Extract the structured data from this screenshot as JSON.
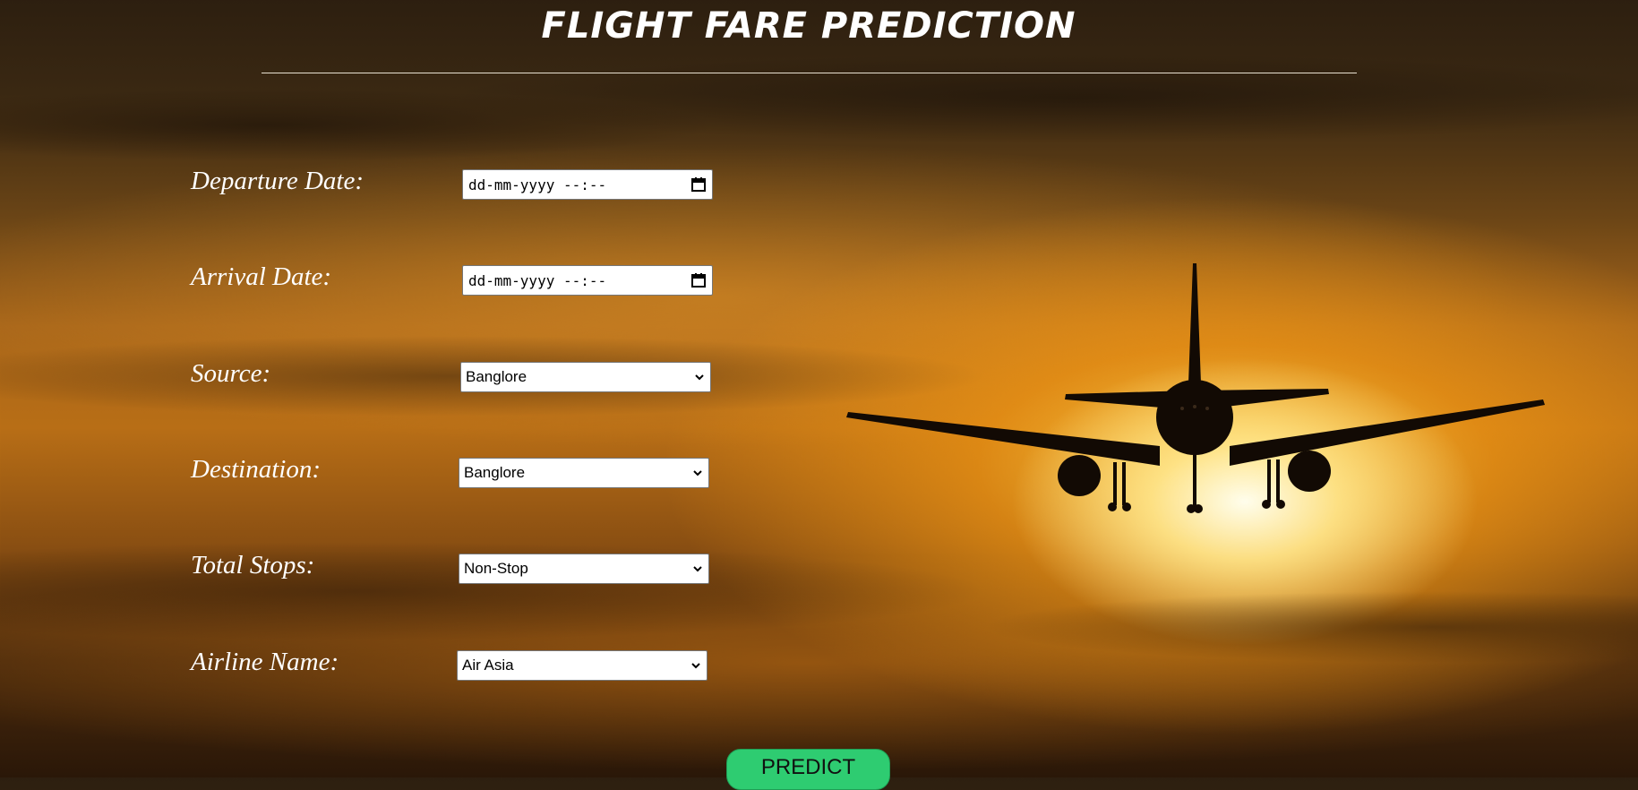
{
  "header": {
    "title": "FLIGHT FARE PREDICTION"
  },
  "form": {
    "departure": {
      "label": "Departure Date:",
      "value": "dd-mm-yyyy --:--",
      "icon": "calendar-icon"
    },
    "arrival": {
      "label": "Arrival Date:",
      "value": "dd-mm-yyyy --:--",
      "icon": "calendar-icon"
    },
    "source": {
      "label": "Source:",
      "selected": "Banglore"
    },
    "destination": {
      "label": "Destination:",
      "selected": "Banglore"
    },
    "stops": {
      "label": "Total Stops:",
      "selected": "Non-Stop"
    },
    "airline": {
      "label": "Airline Name:",
      "selected": "Air Asia"
    },
    "predict_label": "PREDICT"
  },
  "colors": {
    "button": "#2ecc71",
    "title": "#ffffff"
  }
}
